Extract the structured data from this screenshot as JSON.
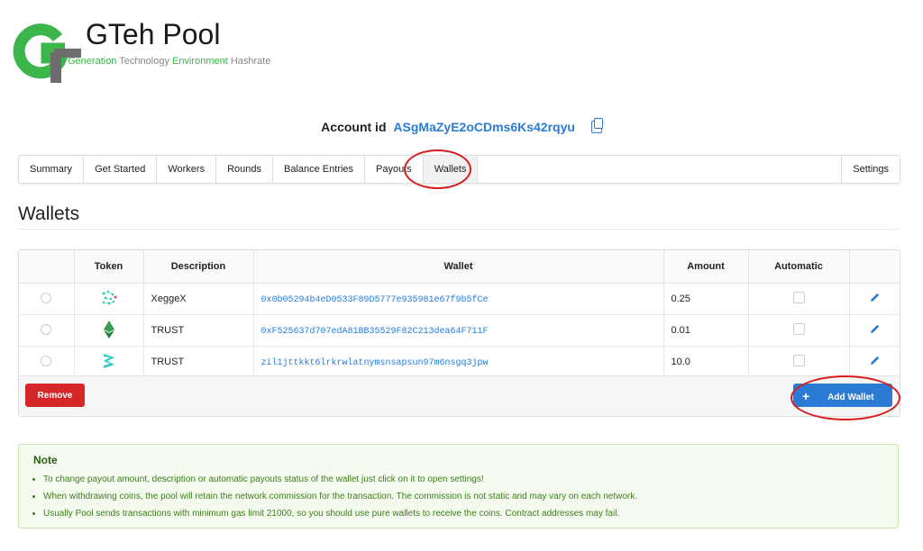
{
  "brand": {
    "title": "GTeh Pool",
    "subtitle_parts": [
      {
        "text": "Generation",
        "green": true
      },
      {
        "text": " Technology ",
        "green": false
      },
      {
        "text": "Environment",
        "green": true
      },
      {
        "text": " Hashrate",
        "green": false
      }
    ],
    "colors": {
      "green": "#3cb54a",
      "gray": "#6d6d6d"
    }
  },
  "account": {
    "label": "Account id",
    "id": "ASgMaZyE2oCDms6Ks42rqyu",
    "copy_icon": "copy-icon"
  },
  "tabs": [
    "Summary",
    "Get Started",
    "Workers",
    "Rounds",
    "Balance Entries",
    "Payouts",
    "Wallets",
    "Settings"
  ],
  "active_tab": "Wallets",
  "page_title": "Wallets",
  "table": {
    "headers": [
      "",
      "Token",
      "Description",
      "Wallet",
      "Amount",
      "Automatic",
      ""
    ],
    "rows": [
      {
        "token_icon": "xeggex-icon",
        "description": "XeggeX",
        "wallet": "0x0b05294b4eD0533F89D5777e935981e67f9b5fCe",
        "amount": "0.25"
      },
      {
        "token_icon": "ethereum-icon",
        "description": "TRUST",
        "wallet": "0xF525637d707edA81BB35529F82C213dea64F711F",
        "amount": "0.01"
      },
      {
        "token_icon": "zilliqa-icon",
        "description": "TRUST",
        "wallet": "zil1jttkkt6lrkrwlatnymsnsapsun97m6nsgq3jpw",
        "amount": "10.0"
      }
    ]
  },
  "buttons": {
    "remove": "Remove",
    "add_wallet": "Add Wallet",
    "plus": "+"
  },
  "note": {
    "title": "Note",
    "items": [
      "To change payout amount, description or automatic payouts status of the wallet just click on it to open settings!",
      "When withdrawing coins, the pool will retain the network commission for the transaction. The commission is not static and may vary on each network.",
      "Usually Pool sends transactions with minimum gas limit 21000, so you should use pure wallets to receive the coins. Contract addresses may fail."
    ]
  },
  "accent_colors": {
    "link": "#2b7bd5",
    "danger": "#d62728",
    "annotation": "#d61d1d"
  }
}
